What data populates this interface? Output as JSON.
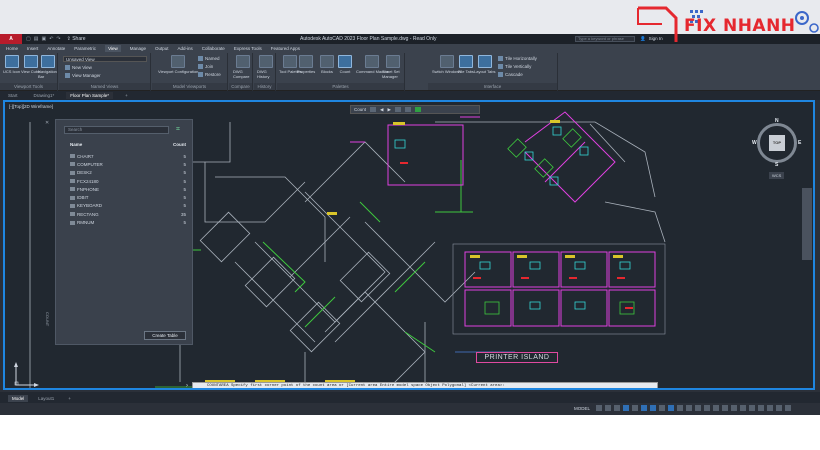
{
  "window": {
    "app_badge": "A",
    "app_badge_sub": "CAD",
    "share_label": "Share",
    "title": "Autodesk AutoCAD 2023   Floor Plan Sample.dwg - Read Only",
    "search_placeholder": "Type a keyword or phrase",
    "user_label": "Sign In"
  },
  "ribbon": {
    "tabs": [
      "Home",
      "Insert",
      "Annotate",
      "Parametric",
      "View",
      "Manage",
      "Output",
      "Add-ins",
      "Collaborate",
      "Express Tools",
      "Featured Apps"
    ],
    "active_tab": "View",
    "panels": {
      "viewport_tools": {
        "label": "Viewport Tools",
        "buttons": [
          "UCS Icon",
          "View Cube",
          "Navigation Bar"
        ]
      },
      "named_views": {
        "label": "Named Views",
        "combo": "Unsaved View",
        "items": [
          "New View",
          "View Manager"
        ]
      },
      "model_viewports": {
        "label": "Model Viewports",
        "buttons": [
          "Viewport Configuration"
        ],
        "items": [
          "Named",
          "Join",
          "Restore"
        ]
      },
      "compare": {
        "label": "Compare",
        "buttons": [
          "DWG Compare"
        ]
      },
      "history": {
        "label": "History",
        "buttons": [
          "DWG History"
        ]
      },
      "palettes": {
        "label": "Palettes",
        "buttons": [
          "Tool Palettes",
          "Properties",
          "Blocks",
          "Count",
          "Command Macros",
          "Sheet Set Manager"
        ]
      },
      "interface": {
        "label": "Interface",
        "buttons": [
          "Switch Windows",
          "File Tabs",
          "Layout Tabs"
        ],
        "items": [
          "Tile Horizontally",
          "Tile Vertically",
          "Cascade"
        ]
      }
    }
  },
  "doc_tabs": {
    "items": [
      "Start",
      "Drawing1*",
      "Floor Plan Sample*"
    ],
    "active": "Floor Plan Sample*"
  },
  "viewport": {
    "label": "[-][Top][2D Wireframe]",
    "countbar": {
      "label": "Count",
      "value": "0"
    },
    "viewcube": {
      "top": "TOP",
      "n": "N",
      "s": "S",
      "e": "E",
      "w": "W",
      "wcs": "WCS"
    },
    "printer_label": "PRINTER ISLAND"
  },
  "count_panel": {
    "search_placeholder": "Search",
    "col_name": "Name",
    "col_count": "Count",
    "rows": [
      {
        "name": "CHAIR7",
        "count": "5"
      },
      {
        "name": "COMPUTER",
        "count": "5"
      },
      {
        "name": "DESK2",
        "count": "5"
      },
      {
        "name": "FCX24180",
        "count": "5"
      },
      {
        "name": "FNPHONE",
        "count": "5"
      },
      {
        "name": "IDBIT",
        "count": "5"
      },
      {
        "name": "KEYBOARD",
        "count": "5"
      },
      {
        "name": "RECTANG",
        "count": "35"
      },
      {
        "name": "RMNUM",
        "count": "5"
      }
    ],
    "create_button": "Create Table",
    "side_label": "COUNT"
  },
  "command_line": {
    "text": "COUNTAREA Specify first corner point of the count area or [Current area Entire model space Object Polygonal] <Current area>:"
  },
  "layout_tabs": {
    "items": [
      "Model",
      "Layout1"
    ],
    "active": "Model"
  },
  "status_bar": {
    "model_label": "MODEL"
  },
  "watermark": {
    "text": "FIX NHANH"
  },
  "colors": {
    "accent": "#1f86e0",
    "canvas": "#212830",
    "magenta": "#e040e0",
    "green": "#3ec93e",
    "yellow": "#d9c52a",
    "cyan": "#33d6d6",
    "red": "#e5282f"
  }
}
